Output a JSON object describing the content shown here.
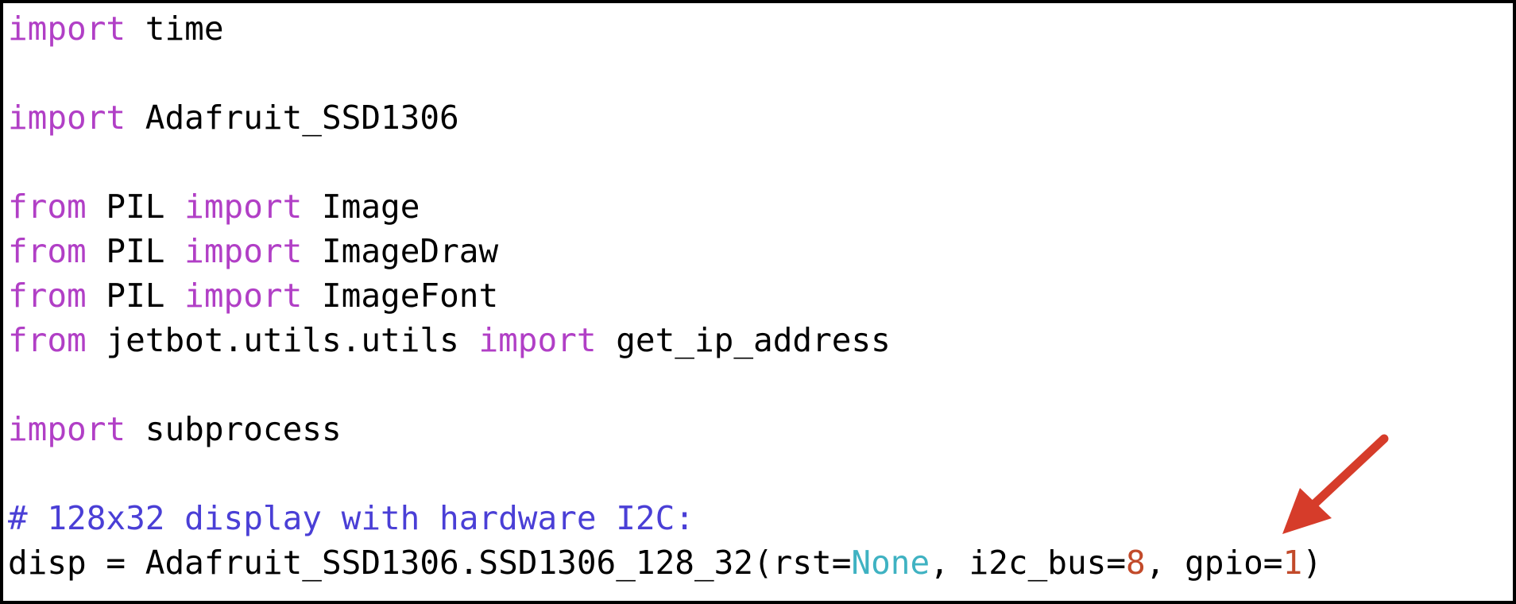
{
  "code": {
    "line1": {
      "kw": "import",
      "rest": " time"
    },
    "line3": {
      "kw": "import",
      "rest": " Adafruit_SSD1306"
    },
    "line5": {
      "kw1": "from",
      "mid": " PIL ",
      "kw2": "import",
      "rest": " Image"
    },
    "line6": {
      "kw1": "from",
      "mid": " PIL ",
      "kw2": "import",
      "rest": " ImageDraw"
    },
    "line7": {
      "kw1": "from",
      "mid": " PIL ",
      "kw2": "import",
      "rest": " ImageFont"
    },
    "line8": {
      "kw1": "from",
      "mid": " jetbot.utils.utils ",
      "kw2": "import",
      "rest": " get_ip_address"
    },
    "line10": {
      "kw": "import",
      "rest": " subprocess"
    },
    "line12": {
      "comment": "# 128x32 display with hardware I2C:"
    },
    "line13": {
      "p1": "disp = Adafruit_SSD1306.SSD1306_128_32(rst=",
      "none": "None",
      "p2": ", i2c_bus=",
      "bus": "8",
      "p3": ", gpio=",
      "gpio": "1",
      "p4": ")"
    }
  },
  "colors": {
    "keyword": "#b13fc6",
    "comment": "#4a3fd6",
    "constant": "#3fb2c2",
    "number": "#c24a2a",
    "arrow": "#d63c2a"
  },
  "icons": {
    "arrow": "red-arrow-icon"
  }
}
